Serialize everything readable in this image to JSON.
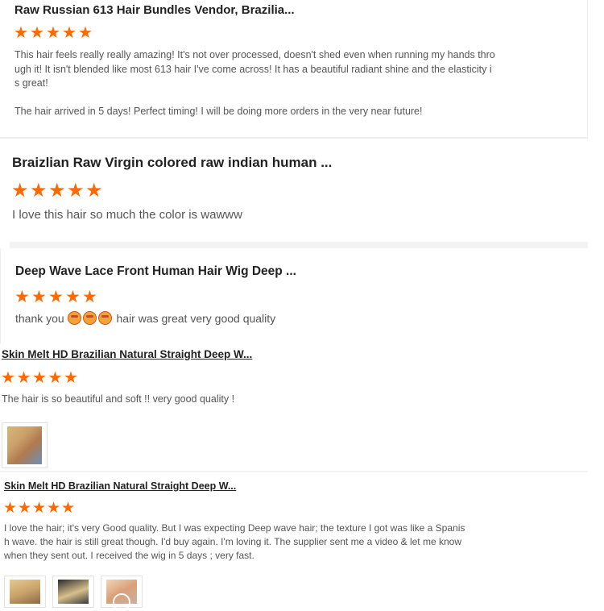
{
  "reviews": [
    {
      "title": "Raw Russian 613 Hair Bundles Vendor, Brazilia...",
      "stars": 5,
      "text": "This hair feels really really amazing! It's not over processed, doesn't shed even when running my hands thro\nugh it! It isn't blended like most 613 hair I've come across! It has a beautiful radiant shine and the elasticity i\ns great!\n\nThe hair arrived in 5 days! Perfect timing! I will be doing more orders in the very near future!"
    },
    {
      "title": "Braizlian Raw Virgin colored raw indian human ...",
      "stars": 5,
      "text": "I love this hair so much the color is wawww"
    },
    {
      "title": "Deep Wave Lace Front Human Hair Wig Deep ...",
      "stars": 5,
      "text_prefix": "thank you",
      "emoji_icon": "heart-eyes-emoji-icon",
      "emoji_count": 3,
      "text_suffix": "hair was great very good quality"
    },
    {
      "title": "Skin Melt HD Brazilian Natural Straight Deep W...",
      "stars": 5,
      "text": "The hair is so beautiful and soft !! very good quality !",
      "photos": 1
    },
    {
      "title": "Skin Melt HD Brazilian Natural Straight Deep W...",
      "stars": 5,
      "text": "I love the hair; it's very Good quality. But I was expecting Deep wave hair; the texture I got was like a Spanis\nh wave. the hair is still great though. I'd buy again. I'm loving it. The supplier sent me a video & let me know\nwhen they sent out. I received the wig in 5 days ; very fast.",
      "photos": 3,
      "video_icon": "play-icon"
    }
  ],
  "colors": {
    "star": "#ff6a00",
    "title": "#222222",
    "text": "#555555"
  }
}
